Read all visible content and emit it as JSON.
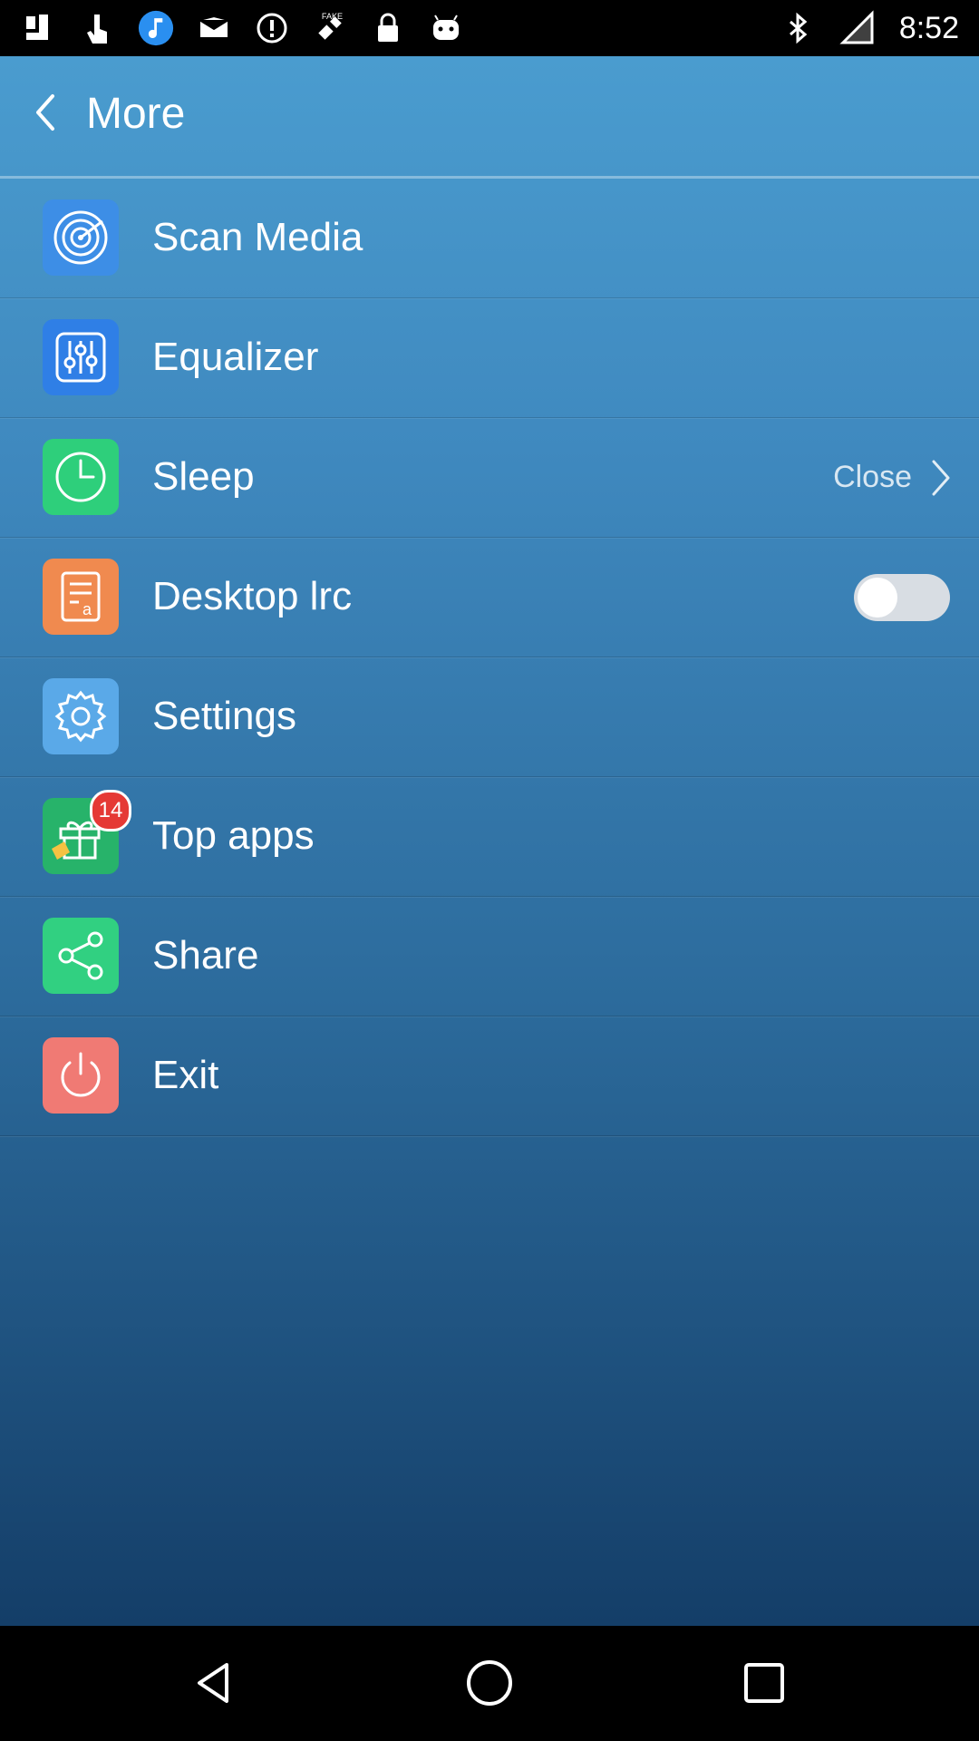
{
  "status_bar": {
    "time": "8:52",
    "left_icons": [
      "photos-icon",
      "hand-pointer-icon",
      "music-note-icon",
      "inbox-icon",
      "alert-icon",
      "fake-gps-icon",
      "lock-icon",
      "android-icon"
    ],
    "right_icons": [
      "bluetooth-icon",
      "no-signal-icon"
    ],
    "gps_text": "FAKE"
  },
  "header": {
    "title": "More"
  },
  "menu": {
    "items": [
      {
        "label": "Scan Media",
        "icon": "radar-icon",
        "color": "#3d8ee6"
      },
      {
        "label": "Equalizer",
        "icon": "sliders-icon",
        "color": "#2f7fe6"
      },
      {
        "label": "Sleep",
        "icon": "clock-icon",
        "color": "#2ecf7b",
        "right_value": "Close"
      },
      {
        "label": "Desktop lrc",
        "icon": "lyrics-doc-icon",
        "color": "#f08a4f",
        "toggle": false
      },
      {
        "label": "Settings",
        "icon": "gear-icon",
        "color": "#5aa9e8"
      },
      {
        "label": "Top apps",
        "icon": "gift-icon",
        "color": "#27b36a",
        "badge": "14"
      },
      {
        "label": "Share",
        "icon": "share-icon",
        "color": "#31d081"
      },
      {
        "label": "Exit",
        "icon": "power-icon",
        "color": "#f07a74"
      }
    ]
  },
  "nav_bar": {
    "buttons": [
      "back",
      "home",
      "recents"
    ]
  }
}
